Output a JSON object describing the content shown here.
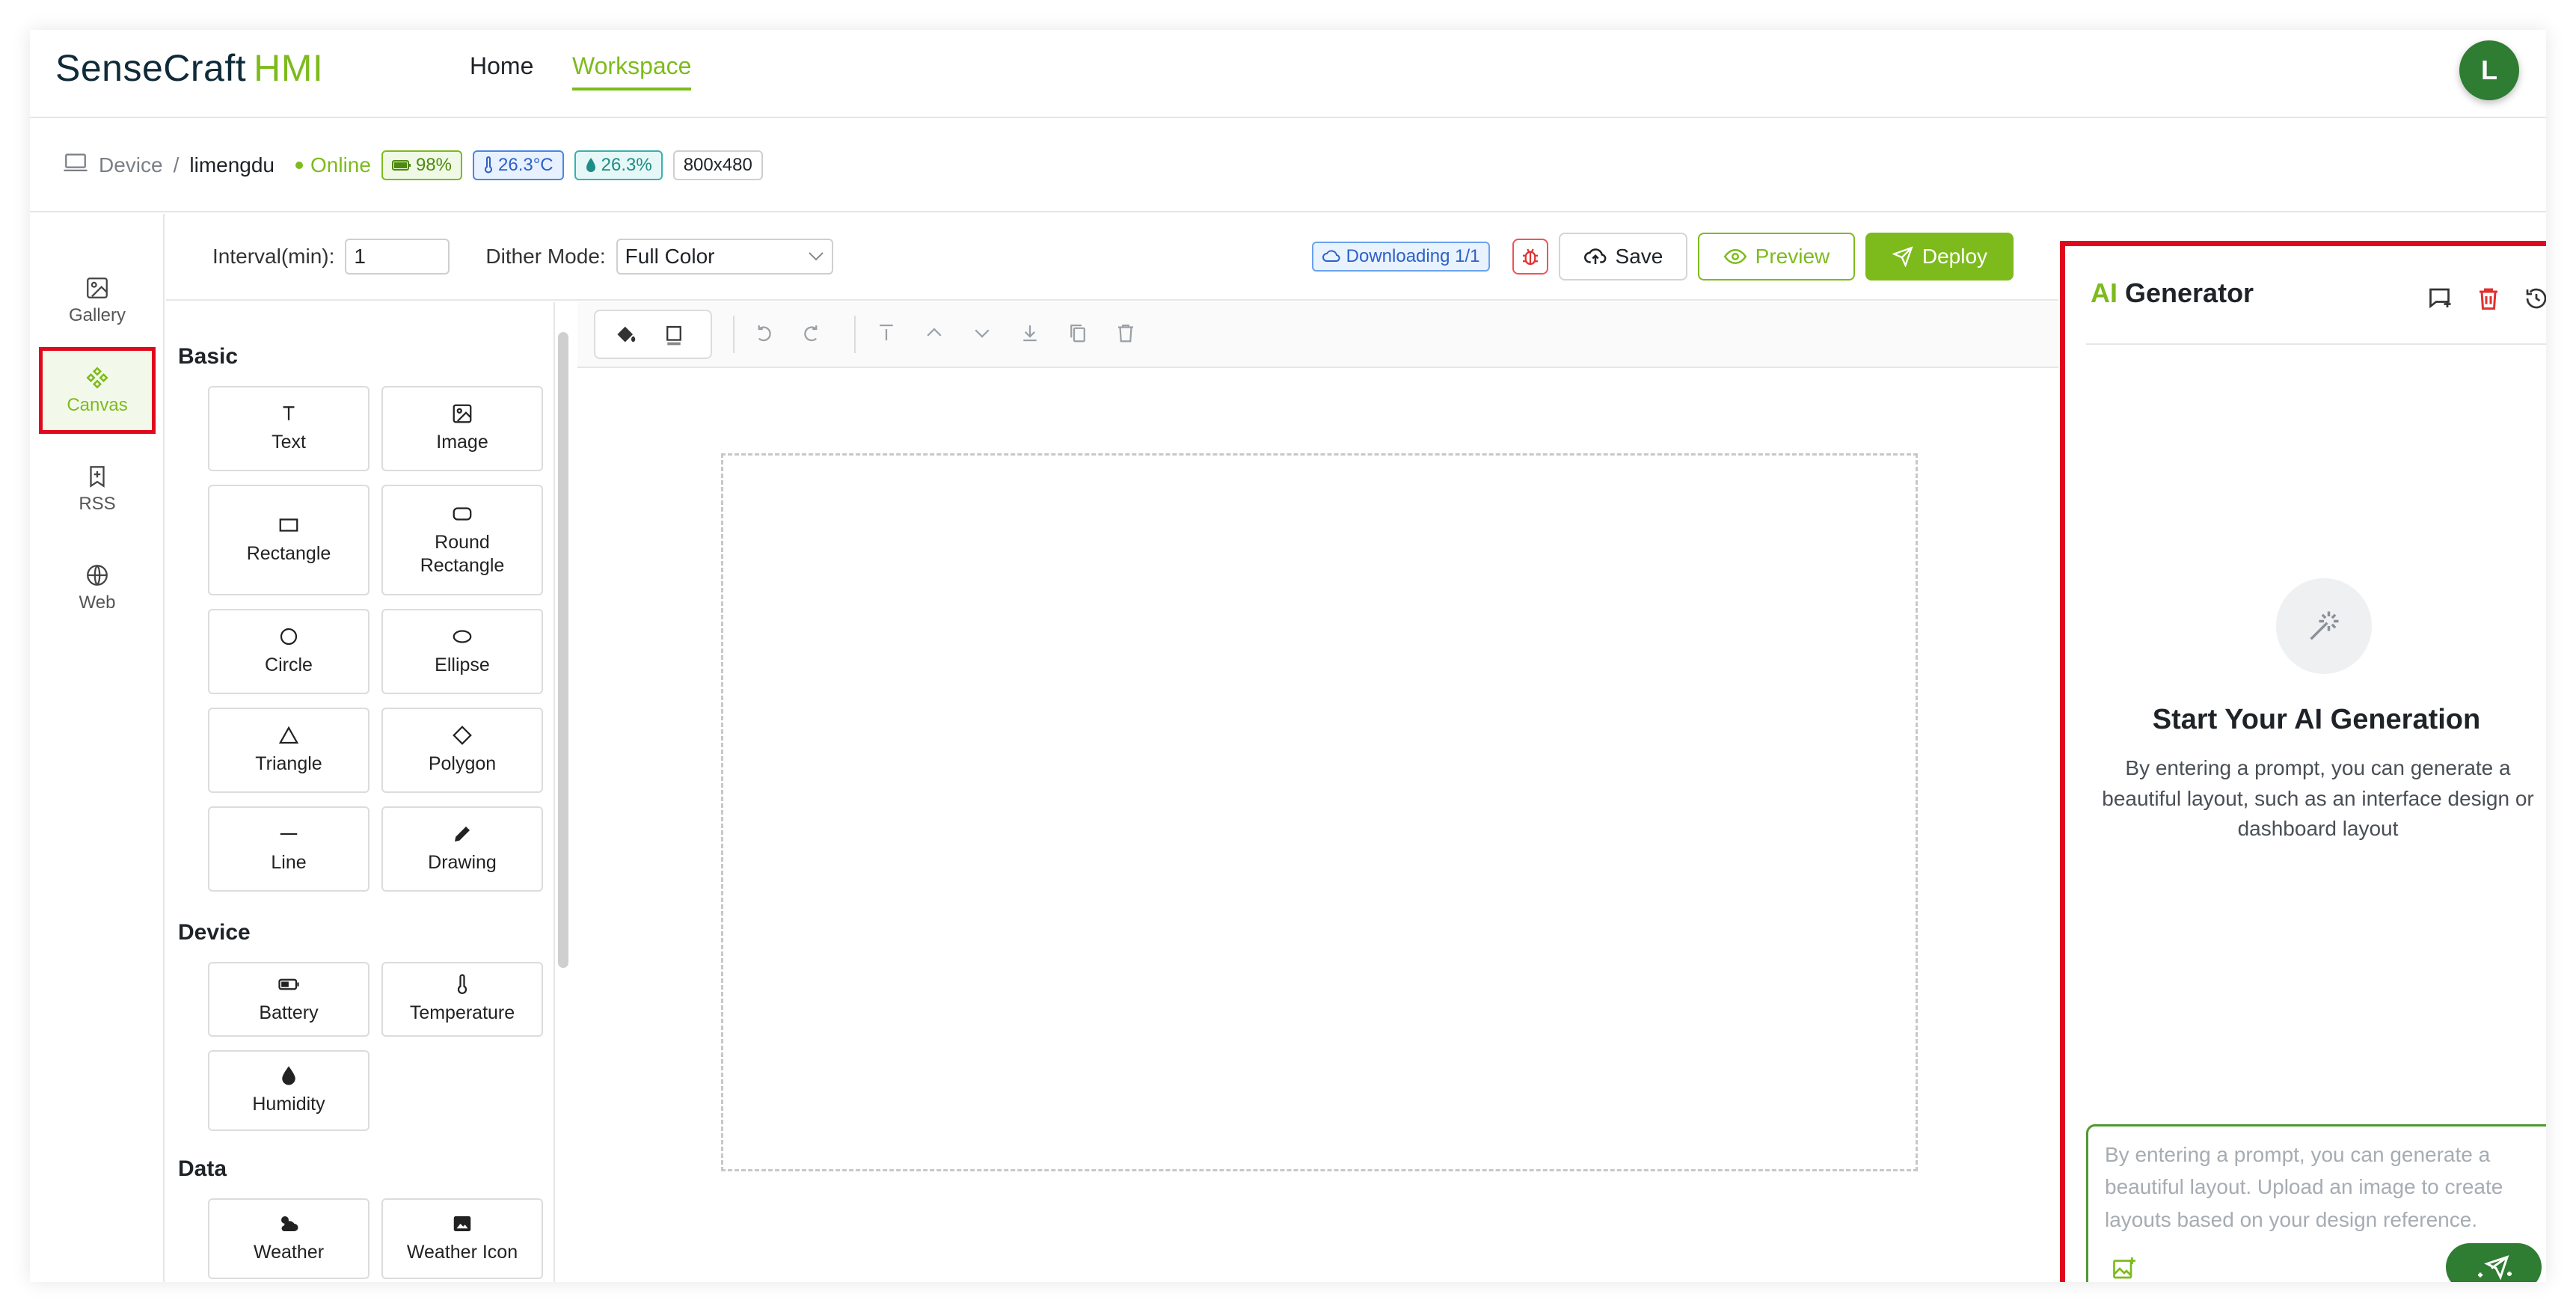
{
  "app": {
    "logo_main": "SenseCraft",
    "logo_accent": "HMI",
    "nav": {
      "home": "Home",
      "workspace": "Workspace"
    },
    "avatar_initial": "L"
  },
  "device": {
    "breadcrumb_root": "Device",
    "separator": "/",
    "name": "limengdu",
    "status": "Online",
    "battery": "98%",
    "temperature": "26.3°C",
    "humidity": "26.3%",
    "resolution": "800x480"
  },
  "rail": {
    "gallery": "Gallery",
    "canvas": "Canvas",
    "rss": "RSS",
    "web": "Web"
  },
  "toolbar": {
    "interval_label": "Interval(min):",
    "interval_value": "1",
    "dither_label": "Dither Mode:",
    "dither_value": "Full Color",
    "downloading": "Downloading 1/1",
    "save": "Save",
    "preview": "Preview",
    "deploy": "Deploy"
  },
  "palette": {
    "basic_title": "Basic",
    "basic": [
      "Text",
      "Image",
      "Rectangle",
      "Round Rectangle",
      "Circle",
      "Ellipse",
      "Triangle",
      "Polygon",
      "Line",
      "Drawing"
    ],
    "device_title": "Device",
    "device": [
      "Battery",
      "Temperature",
      "Humidity"
    ],
    "data_title": "Data",
    "data": [
      "Weather",
      "Weather Icon"
    ]
  },
  "ai": {
    "title_accent": "AI",
    "title_rest": "Generator",
    "empty_title": "Start Your AI Generation",
    "empty_desc": "By entering a prompt, you can generate a beautiful layout, such as an interface design or dashboard layout",
    "placeholder": "By entering a prompt, you can generate a beautiful layout. Upload an image to create layouts based on your design reference."
  },
  "colors": {
    "brand_green": "#7dbb1c",
    "highlight_red": "#e0081c",
    "dark_green": "#2e7d32"
  }
}
